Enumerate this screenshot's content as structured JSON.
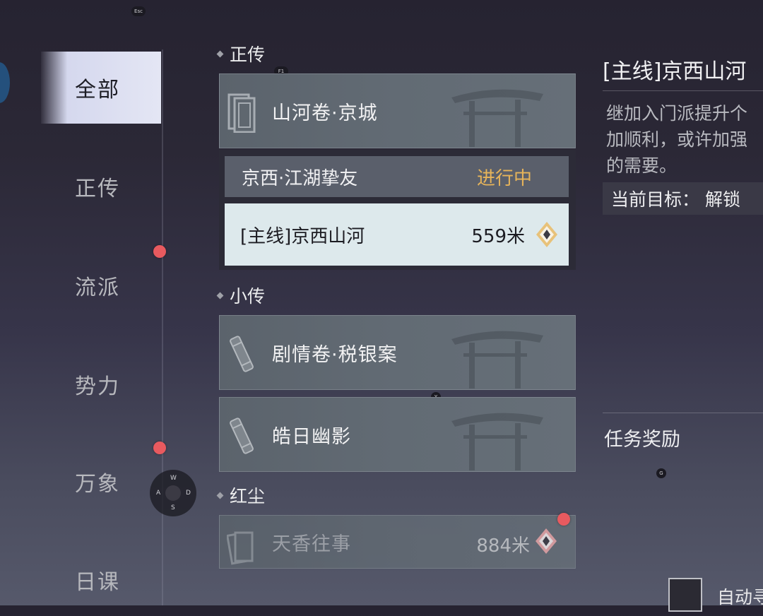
{
  "hotkeys": {
    "esc": "Esc",
    "f1": "F1",
    "y": "Y",
    "g": "G"
  },
  "wasd": {
    "w": "W",
    "a": "A",
    "s": "S",
    "d": "D"
  },
  "sidebar": {
    "items": [
      {
        "label": "全部",
        "active": true
      },
      {
        "label": "正传"
      },
      {
        "label": "流派"
      },
      {
        "label": "势力"
      },
      {
        "label": "万象"
      },
      {
        "label": "日课"
      }
    ]
  },
  "sections": {
    "zhengzhuan": {
      "title": "正传",
      "card": "山河卷·京城",
      "subquests": [
        {
          "name": "京西·江湖挚友",
          "status": "进行中"
        },
        {
          "name": "[主线]京西山河",
          "distance": "559米"
        }
      ]
    },
    "xiaozhuan": {
      "title": "小传",
      "cards": [
        "剧情卷·税银案",
        "皓日幽影"
      ]
    },
    "hongchen": {
      "title": "红尘",
      "card": "天香往事",
      "distance": "884米"
    }
  },
  "detail": {
    "title": "[主线]京西山河",
    "description_lines": [
      "继加入门派提升个",
      "加顺利，或许加强",
      "的需要。"
    ],
    "goal": "当前目标：  解锁",
    "reward_title": "任务奖励",
    "auto_label": "自动寻"
  },
  "colors": {
    "status_in_progress": "#e7b45a",
    "red_dot": "#e85a5f",
    "selected_row": "#dde9ec"
  }
}
